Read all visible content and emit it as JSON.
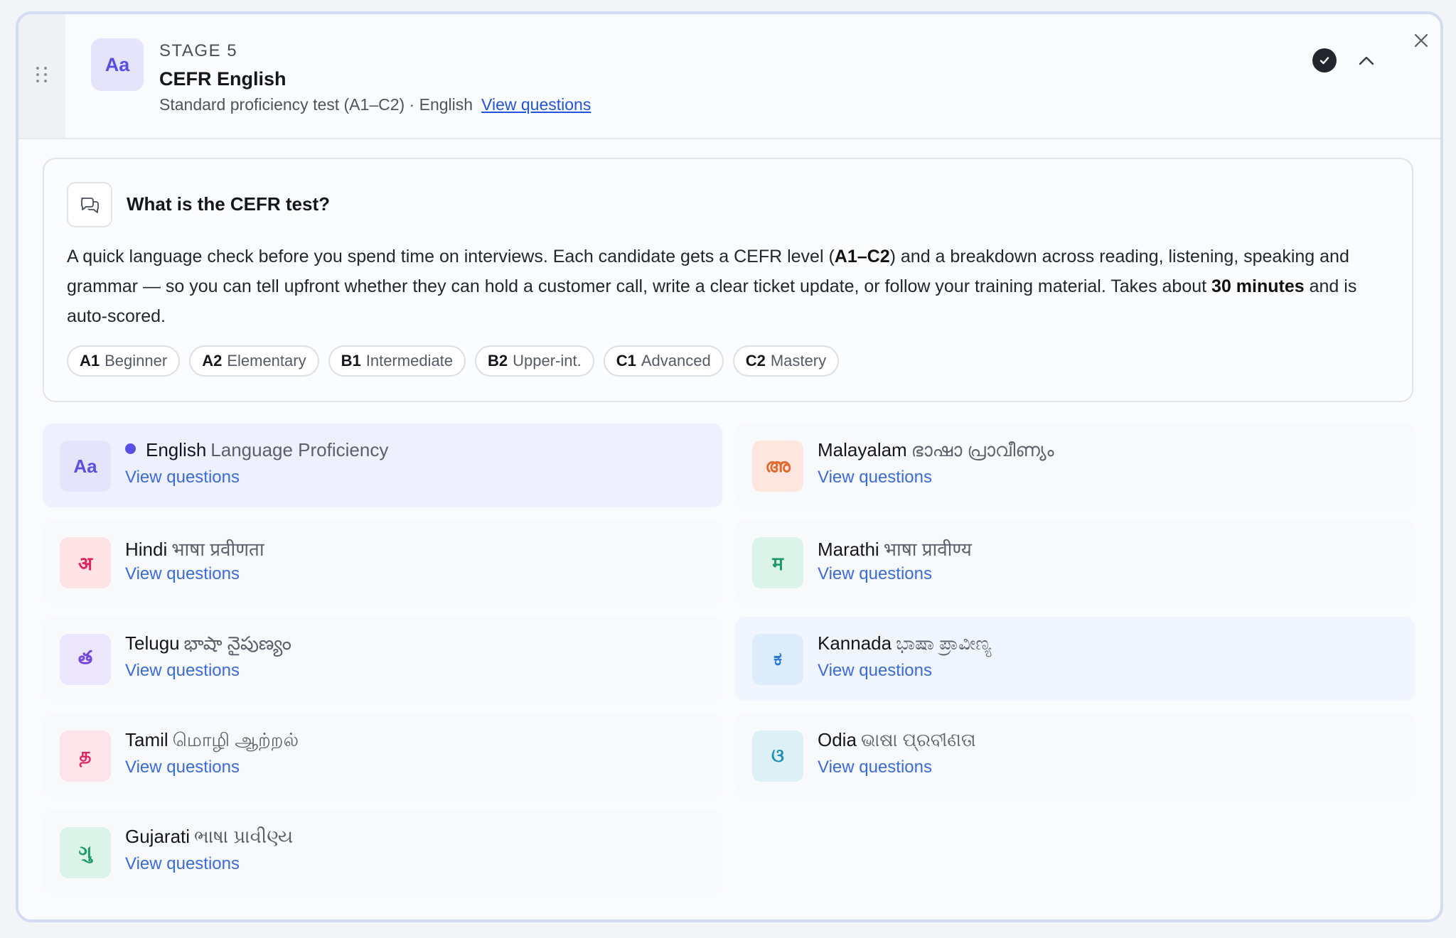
{
  "stage": {
    "label": "STAGE 5",
    "badge": "Aa",
    "title": "CEFR English",
    "subtitle": "Standard proficiency test (A1–C2) · English",
    "view_link": "View questions",
    "status": "completed"
  },
  "info": {
    "title": "What is the CEFR test?",
    "body_1": "A quick language check before you spend time on interviews. Each candidate gets a CEFR level (",
    "body_bold_1": "A1–C2",
    "body_2": ") and a breakdown across reading, listening, speaking and grammar — so you can tell upfront whether they can hold a customer call, write a clear ticket update, or follow your training material. Takes about ",
    "body_bold_2": "30 minutes",
    "body_3": " and is auto-scored.",
    "levels": [
      {
        "code": "A1",
        "name": "Beginner"
      },
      {
        "code": "A2",
        "name": "Elementary"
      },
      {
        "code": "B1",
        "name": "Intermediate"
      },
      {
        "code": "B2",
        "name": "Upper-int."
      },
      {
        "code": "C1",
        "name": "Advanced"
      },
      {
        "code": "C2",
        "name": "Mastery"
      }
    ]
  },
  "languages": [
    {
      "name": "English",
      "native": "Language Proficiency",
      "badge": "Aa",
      "link": "View questions",
      "badge_bg": "#e5e4fb",
      "badge_fg": "#5850e6",
      "selected": true
    },
    {
      "name": "Malayalam",
      "native": "ഭാഷാ പ്രാവീണ്യം",
      "badge": "അ",
      "link": "View questions",
      "badge_bg": "#fde6df",
      "badge_fg": "#e06a2c"
    },
    {
      "name": "Hindi",
      "native": "भाषा प्रवीणता",
      "badge": "अ",
      "link": "View questions",
      "badge_bg": "#fde3e6",
      "badge_fg": "#e0245e"
    },
    {
      "name": "Marathi",
      "native": "भाषा प्रावीण्य",
      "badge": "म",
      "link": "View questions",
      "badge_bg": "#dcf3ea",
      "badge_fg": "#1f9a6c"
    },
    {
      "name": "Telugu",
      "native": "భాషా నైపుణ్యం",
      "badge": "త",
      "link": "View questions",
      "badge_bg": "#ebe6fb",
      "badge_fg": "#7645e0"
    },
    {
      "name": "Kannada",
      "native": "ಭಾಷಾ ಪ್ರಾವೀಣ್ಯ",
      "badge": "ಕ",
      "link": "View questions",
      "badge_bg": "#dcecfb",
      "badge_fg": "#2a7ad8"
    },
    {
      "name": "Tamil",
      "native": "மொழி ஆற்றல்",
      "badge": "த",
      "link": "View questions",
      "badge_bg": "#fde3ea",
      "badge_fg": "#e0245e"
    },
    {
      "name": "Odia",
      "native": "ଭାଷା ପ୍ରବୀଣତା",
      "badge": "ଓ",
      "link": "View questions",
      "badge_bg": "#dcf0f6",
      "badge_fg": "#1d8fb0"
    },
    {
      "name": "Gujarati",
      "native": "ભાષા પ્રાવીણ્ય",
      "badge": "ગુ",
      "link": "View questions",
      "badge_bg": "#dcf3ea",
      "badge_fg": "#1f9a6c"
    }
  ]
}
